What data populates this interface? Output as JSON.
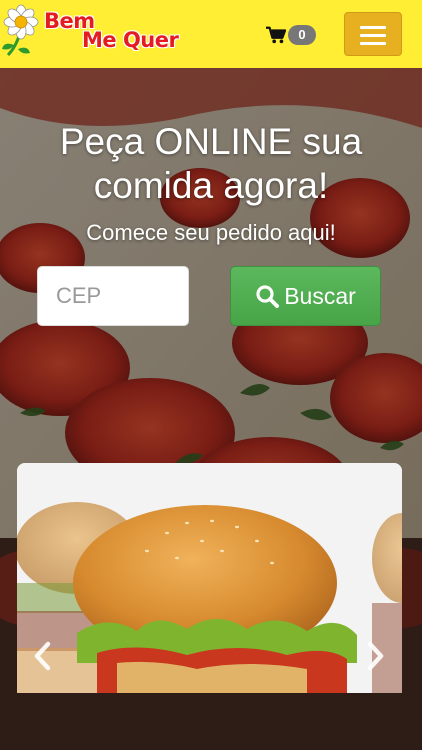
{
  "header": {
    "logo": {
      "line1": "Bem",
      "line2": "Me Quer"
    },
    "cart": {
      "count": "0",
      "icon": "shopping-cart-icon"
    },
    "menu_icon": "hamburger-menu-icon"
  },
  "hero": {
    "title": "Peça ONLINE sua comida agora!",
    "subtitle": "Comece seu pedido aqui!",
    "cep_placeholder": "CEP",
    "cep_value": "",
    "search_button_label": "Buscar",
    "search_icon": "search-icon"
  },
  "carousel": {
    "prev_icon": "chevron-left-icon",
    "next_icon": "chevron-right-icon"
  },
  "colors": {
    "header_bg": "#ffee33",
    "logo_red": "#e41b23",
    "menu_button": "#e6b020",
    "search_button": "#5cb85c",
    "cart_badge": "#777777"
  }
}
